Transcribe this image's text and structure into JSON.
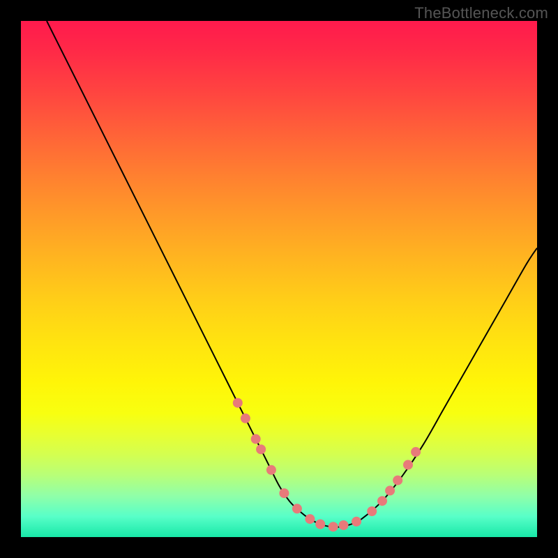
{
  "watermark": "TheBottleneck.com",
  "chart_data": {
    "type": "line",
    "title": "",
    "xlabel": "",
    "ylabel": "",
    "xlim": [
      0,
      100
    ],
    "ylim": [
      0,
      100
    ],
    "series": [
      {
        "name": "bottleneck-curve",
        "x": [
          5,
          8,
          12,
          16,
          20,
          24,
          28,
          32,
          36,
          40,
          44,
          48,
          50,
          52,
          54,
          56,
          58,
          60,
          62,
          64,
          66,
          70,
          74,
          78,
          82,
          86,
          90,
          94,
          98,
          100
        ],
        "y": [
          100,
          94,
          86,
          78,
          70,
          62,
          54,
          46,
          38,
          30,
          22,
          14,
          10,
          7,
          5,
          3.5,
          2.5,
          2,
          2,
          2.5,
          3.5,
          7,
          12,
          18,
          25,
          32,
          39,
          46,
          53,
          56
        ]
      }
    ],
    "marked_points": {
      "name": "highlight-dots",
      "x": [
        42,
        43.5,
        45.5,
        46.5,
        48.5,
        51,
        53.5,
        56,
        58,
        60.5,
        62.5,
        65,
        68,
        70,
        71.5,
        73,
        75,
        76.5
      ],
      "y": [
        26,
        23,
        19,
        17,
        13,
        8.5,
        5.5,
        3.5,
        2.5,
        2,
        2.3,
        3,
        5,
        7,
        9,
        11,
        14,
        16.5
      ]
    },
    "colors": {
      "gradient_top": "#ff1a4d",
      "gradient_mid": "#ffe310",
      "gradient_bottom": "#18e8a8",
      "curve": "#000000",
      "dots": "#e87a7a",
      "frame": "#000000"
    }
  }
}
